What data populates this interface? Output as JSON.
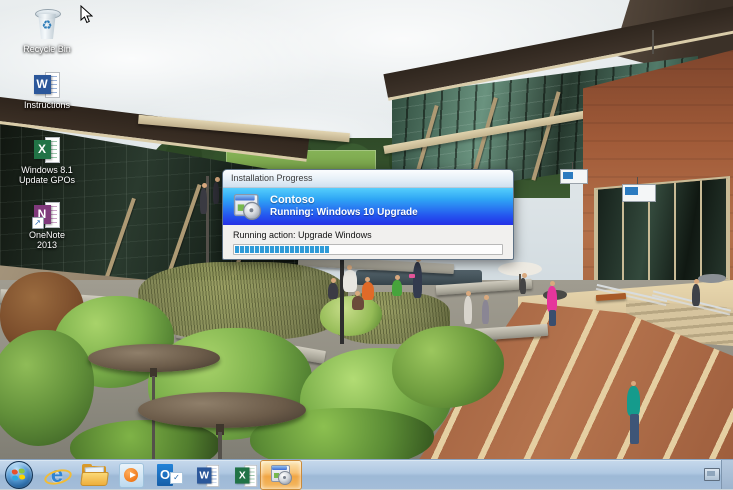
{
  "desktop_icons": [
    {
      "name": "recycle-bin",
      "lines": [
        "Recycle Bin"
      ]
    },
    {
      "name": "instructions",
      "lines": [
        "Instructions"
      ]
    },
    {
      "name": "windows-81-update-gpos",
      "lines": [
        "Windows 8.1",
        "Update GPOs"
      ]
    },
    {
      "name": "onenote-2013",
      "lines": [
        "OneNote",
        "2013"
      ]
    }
  ],
  "dialog": {
    "title": "Installation Progress",
    "app_name": "Contoso",
    "status": "Running: Windows 10 Upgrade",
    "action": "Running action: Upgrade Windows",
    "progress_percent": 35
  },
  "taskbar": {
    "buttons": [
      "start",
      "internet-explorer",
      "file-explorer",
      "windows-media-player",
      "outlook",
      "word",
      "excel",
      "installation-progress"
    ],
    "active_button": "installation-progress"
  },
  "colors": {
    "banner_gradient_top": "#55CEFC",
    "banner_gradient_bottom": "#2531E6",
    "progress_fill": "#2E9BD8",
    "taskbar_base": "#AFC8E2",
    "active_button_highlight": "#F0A544"
  }
}
